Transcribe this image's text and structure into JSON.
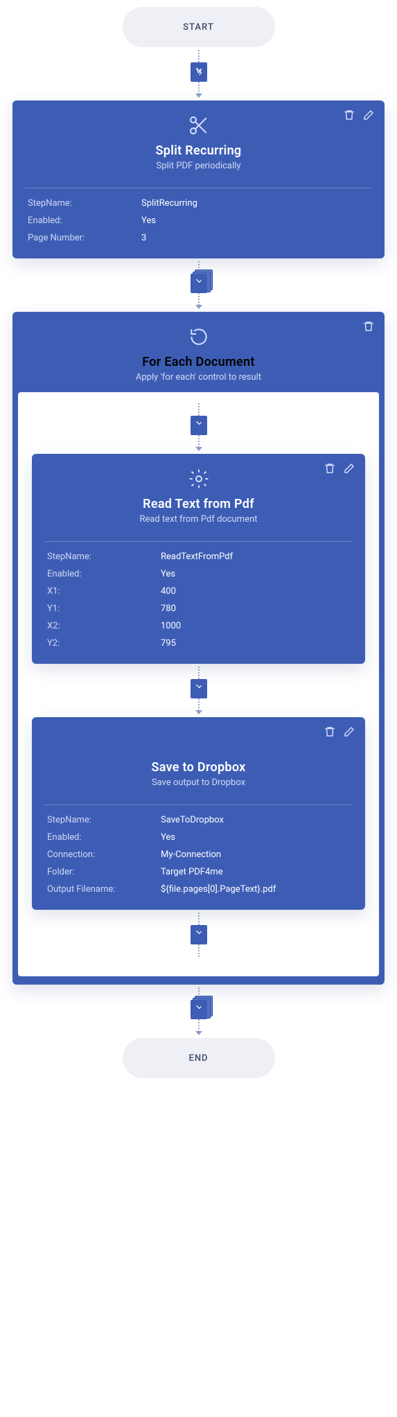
{
  "terminals": {
    "start": "START",
    "end": "END"
  },
  "step1": {
    "title": "Split Recurring",
    "subtitle": "Split PDF periodically",
    "rows": {
      "stepNameK": "StepName:",
      "stepNameV": "SplitRecurring",
      "enabledK": "Enabled:",
      "enabledV": "Yes",
      "pageNumK": "Page Number:",
      "pageNumV": "3"
    }
  },
  "loop": {
    "title": "For Each Document",
    "subtitle": "Apply 'for each' control to result"
  },
  "step2": {
    "title": "Read Text from Pdf",
    "subtitle": "Read text from Pdf document",
    "rows": {
      "stepNameK": "StepName:",
      "stepNameV": "ReadTextFromPdf",
      "enabledK": "Enabled:",
      "enabledV": "Yes",
      "x1K": "X1:",
      "x1V": "400",
      "y1K": "Y1:",
      "y1V": "780",
      "x2K": "X2:",
      "x2V": "1000",
      "y2K": "Y2:",
      "y2V": "795"
    }
  },
  "step3": {
    "title": "Save to Dropbox",
    "subtitle": "Save output to Dropbox",
    "rows": {
      "stepNameK": "StepName:",
      "stepNameV": "SaveToDropbox",
      "enabledK": "Enabled:",
      "enabledV": "Yes",
      "connK": "Connection:",
      "connV": "My-Connection",
      "folderK": "Folder:",
      "folderV": "Target PDF4me",
      "fnameK": "Output Filename:",
      "fnameV": "${file.pages[0].PageText}.pdf"
    }
  }
}
